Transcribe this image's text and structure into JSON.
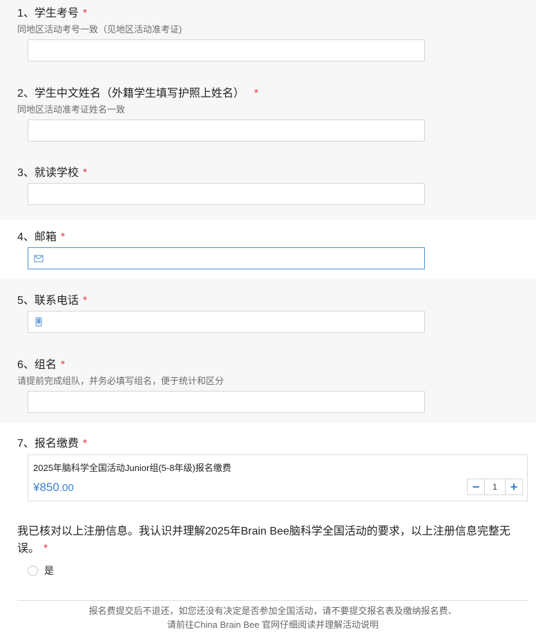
{
  "questions": [
    {
      "number": "1、",
      "title": "学生考号",
      "required": "*",
      "hint": "同地区活动考号一致（见地区活动准考证)",
      "value": ""
    },
    {
      "number": "2、",
      "title": "学生中文姓名（外籍学生填写护照上姓名）",
      "required": "*",
      "hint": "同地区活动准考证姓名一致",
      "value": ""
    },
    {
      "number": "3、",
      "title": "就读学校",
      "required": "*",
      "value": ""
    },
    {
      "number": "4、",
      "title": "邮箱",
      "required": "*",
      "icon": "mail-icon",
      "value": ""
    },
    {
      "number": "5、",
      "title": "联系电话",
      "required": "*",
      "icon": "phone-icon",
      "value": ""
    },
    {
      "number": "6、",
      "title": "组名",
      "required": "*",
      "hint": "请提前完成组队，并务必填写组名，便于统计和区分",
      "value": ""
    },
    {
      "number": "7、",
      "title": "报名缴费",
      "required": "*"
    }
  ],
  "payment": {
    "product_name": "2025年脑科学全国活动Junior组(5-8年级)报名缴费",
    "price_main": "¥850",
    "price_decimal": ".00",
    "quantity": "1",
    "minus": "−",
    "plus": "+"
  },
  "confirm": {
    "text": "我已核对以上注册信息。我认识并理解2025年Brain Bee脑科学全国活动的要求，以上注册信息完整无误。",
    "required": "*",
    "option": "是"
  },
  "footer": {
    "line1": "报名费提交后不退还，如您还没有决定是否参加全国活动，请不要提交报名表及缴纳报名费、",
    "line2": "请前往China Brain Bee 官网仔细阅读并理解活动说明"
  },
  "colors": {
    "accent": "#3a7fd0",
    "required": "#e4393c",
    "focus_border": "#4a90d9",
    "shade": "#f7f7f8"
  }
}
